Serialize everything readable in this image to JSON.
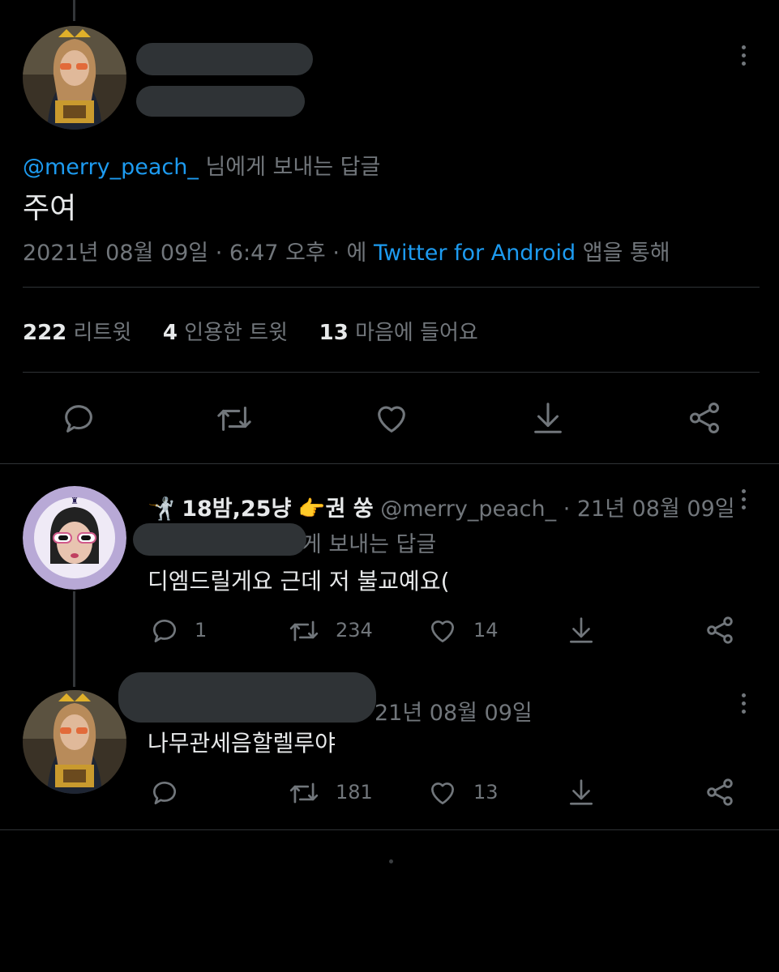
{
  "main_tweet": {
    "reply_to_handle": "@merry_peach_",
    "reply_to_suffix": " 님에게 보내는 답글",
    "text": "주여",
    "date": "2021년 08월 09일 · 6:47 오후 · 에 ",
    "client": "Twitter for Android",
    "client_suffix": " 앱을 통해",
    "stats": {
      "retweets_num": "222",
      "retweets_label": "리트윗",
      "quotes_num": "4",
      "quotes_label": "인용한 트윗",
      "likes_num": "13",
      "likes_label": "마음에 들어요"
    }
  },
  "reply1": {
    "name": "18밤,25냥",
    "name_suffix": "권 쑹",
    "handle": "@merry_peach_",
    "date": "· 21년 08월 09일",
    "reply_to_partial": "게 보내는 답글",
    "text": "디엠드릴게요 근데 저 불교예요(",
    "replies": "1",
    "retweets": "234",
    "likes": "14"
  },
  "reply2": {
    "date": "21년 08월 09일",
    "text": "나무관세음할렐루야",
    "retweets": "181",
    "likes": "13"
  },
  "colors": {
    "accent": "#1d9bf0",
    "muted": "#71767b",
    "background": "#000000"
  }
}
